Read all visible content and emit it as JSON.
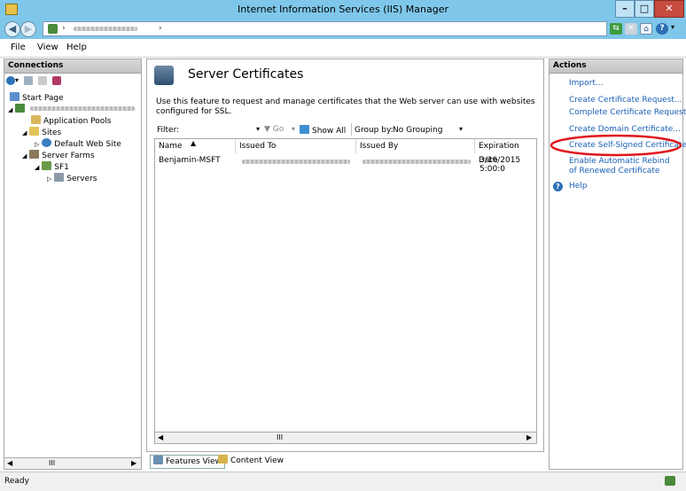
{
  "window": {
    "title": "Internet Information Services (IIS) Manager",
    "min": "–",
    "max": "□",
    "close": "✕"
  },
  "address": {
    "segment_sep": "›"
  },
  "menu": [
    "File",
    "View",
    "Help"
  ],
  "connections": {
    "header": "Connections",
    "tree": {
      "start_page": "Start Page",
      "app_pools": "Application Pools",
      "sites": "Sites",
      "default_site": "Default Web Site",
      "server_farms": "Server Farms",
      "sf1": "SF1",
      "servers": "Servers"
    },
    "scroll_mid": "III"
  },
  "center": {
    "title": "Server Certificates",
    "description": "Use this feature to request and manage certificates that the Web server can use with websites configured for SSL.",
    "filter_label": "Filter:",
    "go_label": "Go",
    "show_all_label": "Show All",
    "group_by_label": "Group by:",
    "group_by_value": "No Grouping",
    "columns": [
      "Name",
      "Issued To",
      "Issued By",
      "Expiration Date"
    ],
    "rows": [
      {
        "name": "Benjamin-MSFT",
        "expiration": "3/16/2015 5:00:0"
      }
    ],
    "scroll_mid": "III",
    "tabs": {
      "features": "Features View",
      "content": "Content View"
    }
  },
  "actions": {
    "header": "Actions",
    "items": {
      "import": "Import...",
      "create_request": "Create Certificate Request...",
      "complete_request": "Complete Certificate Request...",
      "domain_cert": "Create Domain Certificate...",
      "self_signed": "Create Self-Signed Certificate...",
      "auto_rebind": "Enable Automatic Rebind of Renewed Certificate",
      "help": "Help"
    }
  },
  "status": {
    "text": "Ready"
  },
  "colors": {
    "titlebar": "#7fc7ea",
    "link": "#1a5fb4",
    "highlight_ellipse": "#e0161b"
  }
}
